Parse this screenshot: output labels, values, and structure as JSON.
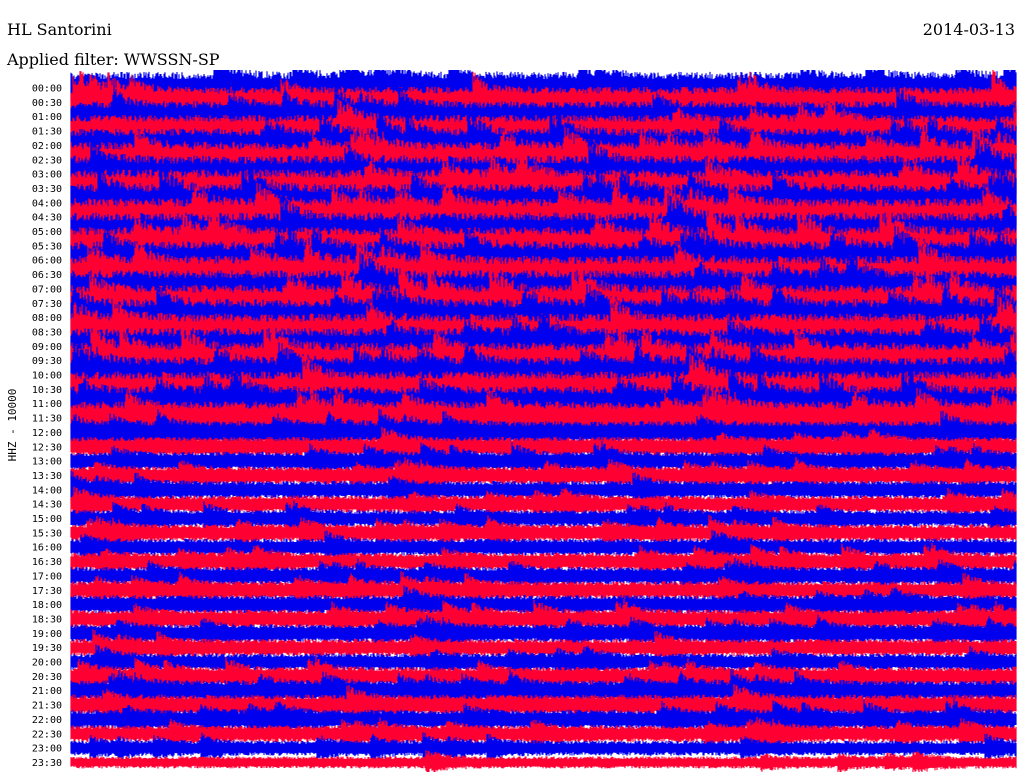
{
  "header": {
    "station": "HL Santorini",
    "date": "2014-03-13",
    "filter_label": "Applied filter: WWSSN-SP"
  },
  "chart_data": {
    "type": "line",
    "title": "HL Santorini",
    "ylabel": "HHZ - 10000",
    "y_tick_labels": [
      "00:00",
      "00:30",
      "01:00",
      "01:30",
      "02:00",
      "02:30",
      "03:00",
      "03:30",
      "04:00",
      "04:30",
      "05:00",
      "05:30",
      "06:00",
      "06:30",
      "07:00",
      "07:30",
      "08:00",
      "08:30",
      "09:00",
      "09:30",
      "10:00",
      "10:30",
      "11:00",
      "11:30",
      "12:00",
      "12:30",
      "13:00",
      "13:30",
      "14:00",
      "14:30",
      "15:00",
      "15:30",
      "16:00",
      "16:30",
      "17:00",
      "17:30",
      "18:00",
      "18:30",
      "19:00",
      "19:30",
      "20:00",
      "20:30",
      "21:00",
      "21:30",
      "22:00",
      "22:30",
      "23:00",
      "23:30"
    ],
    "trace_colors": [
      "#0000ee",
      "#ff0033"
    ],
    "relative_amplitude": [
      0.85,
      0.82,
      0.82,
      0.85,
      0.9,
      0.95,
      0.98,
      1.0,
      1.0,
      1.0,
      1.0,
      1.0,
      1.0,
      1.0,
      0.98,
      0.98,
      0.98,
      0.98,
      0.96,
      0.96,
      0.95,
      0.95,
      0.92,
      0.88,
      0.6,
      0.52,
      0.5,
      0.48,
      0.48,
      0.46,
      0.45,
      0.45,
      0.46,
      0.47,
      0.48,
      0.48,
      0.5,
      0.5,
      0.48,
      0.46,
      0.46,
      0.5,
      0.55,
      0.55,
      0.52,
      0.45,
      0.4,
      0.32
    ],
    "colors": {
      "blue": "#0000ee",
      "red": "#ff0033",
      "background": "#ffffff"
    }
  }
}
